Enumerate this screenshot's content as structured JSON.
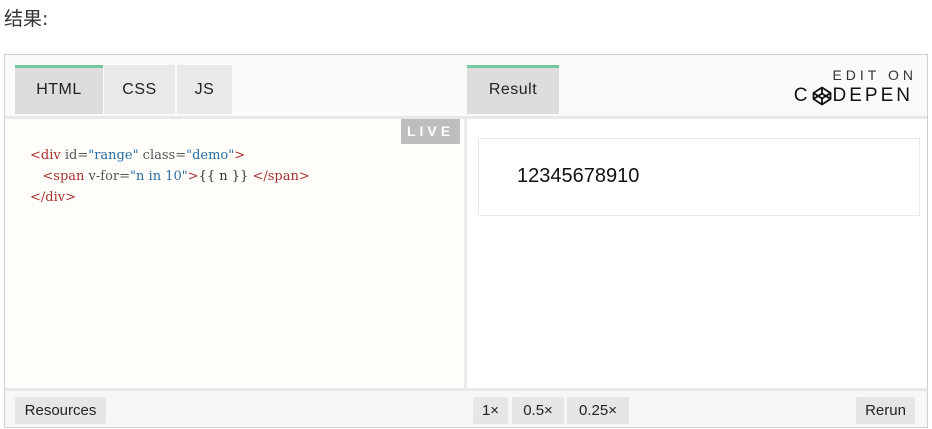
{
  "page": {
    "heading": "结果:"
  },
  "tabs": {
    "html": "HTML",
    "css": "CSS",
    "js": "JS",
    "result": "Result"
  },
  "branding": {
    "line1": "EDIT ON",
    "line2_left": "C",
    "line2_right": "DEPEN",
    "icon": "codepen-logo-icon"
  },
  "editor": {
    "live_badge": "LIVE",
    "lines": [
      {
        "open": "<div",
        "attr1": " id=",
        "val1": "\"range\"",
        "attr2": " class=",
        "val2": "\"demo\"",
        "close": ">"
      },
      {
        "indent": "   ",
        "open": "<span",
        "attr1": " v-for=",
        "val1": "\"n in 10\"",
        "close": ">",
        "mustache": "{{ n }}",
        "endtag": " </span>"
      },
      {
        "endtag": "</div>"
      }
    ]
  },
  "result": {
    "text": "12345678910"
  },
  "footer": {
    "resources": "Resources",
    "zoom_options": [
      "1×",
      "0.5×",
      "0.25×"
    ],
    "rerun": "Rerun"
  },
  "colors": {
    "active_tab_accent": "#74c9a1",
    "tag": "#a83131",
    "attr_value": "#2a6ea5"
  }
}
